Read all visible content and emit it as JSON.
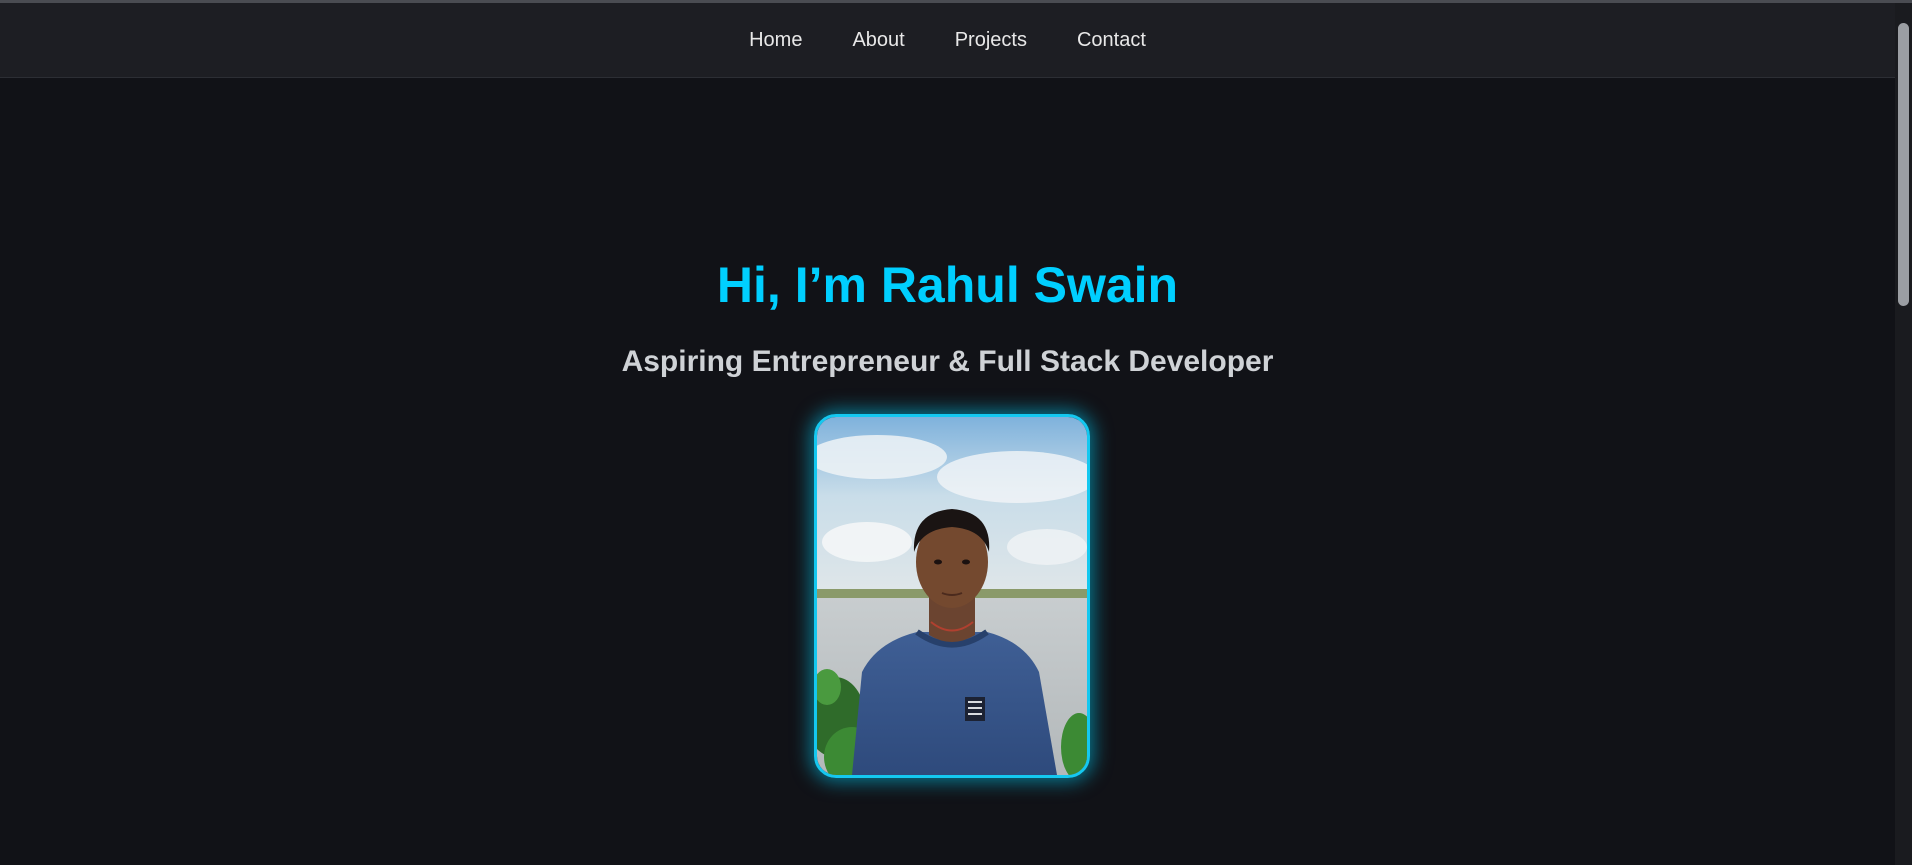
{
  "nav": {
    "items": [
      {
        "label": "Home"
      },
      {
        "label": "About"
      },
      {
        "label": "Projects"
      },
      {
        "label": "Contact"
      }
    ]
  },
  "hero": {
    "title": "Hi, I’m Rahul Swain",
    "subtitle": "Aspiring Entrepreneur & Full Stack Developer"
  },
  "colors": {
    "accent": "#00cfff",
    "background": "#111217",
    "navbar": "#1d1e23"
  }
}
